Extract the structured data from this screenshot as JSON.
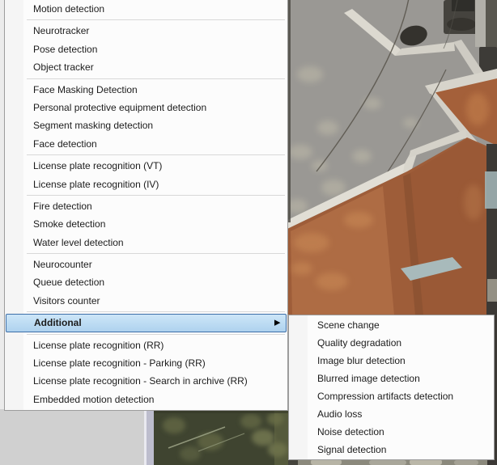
{
  "palette": {
    "menu-bg": "#fcfcfc",
    "menu-border": "#9c9c9c",
    "menu-text": "#1c1c1c",
    "gutter": "#f5f5f5",
    "separator": "#d8d8d8",
    "hl-top": "#cde6f8",
    "hl-bottom": "#aed2ee",
    "hl-border": "#3c6ea8"
  },
  "icons": {
    "submenu_arrow": "▶"
  },
  "main_menu": {
    "items": [
      {
        "label": "Motion detection"
      },
      {
        "label": "Neurotracker"
      },
      {
        "label": "Pose detection"
      },
      {
        "label": "Object tracker"
      },
      {
        "label": "Face Masking Detection"
      },
      {
        "label": "Personal protective equipment detection"
      },
      {
        "label": "Segment masking detection"
      },
      {
        "label": "Face detection"
      },
      {
        "label": "License plate recognition (VT)"
      },
      {
        "label": "License plate recognition (IV)"
      },
      {
        "label": "Fire detection"
      },
      {
        "label": "Smoke detection"
      },
      {
        "label": "Water level detection"
      },
      {
        "label": "Neurocounter"
      },
      {
        "label": "Queue detection"
      },
      {
        "label": "Visitors counter"
      },
      {
        "label": "Additional",
        "highlighted": true,
        "has_submenu": true
      },
      {
        "label": "License plate recognition (RR)"
      },
      {
        "label": "License plate recognition - Parking (RR)"
      },
      {
        "label": "License plate recognition - Search in archive (RR)"
      },
      {
        "label": "Embedded motion detection"
      }
    ]
  },
  "submenu": {
    "items": [
      {
        "label": "Scene change"
      },
      {
        "label": "Quality degradation"
      },
      {
        "label": "Image blur detection"
      },
      {
        "label": "Blurred image detection"
      },
      {
        "label": "Compression artifacts detection"
      },
      {
        "label": "Audio loss"
      },
      {
        "label": "Noise detection"
      },
      {
        "label": "Signal detection"
      }
    ]
  }
}
